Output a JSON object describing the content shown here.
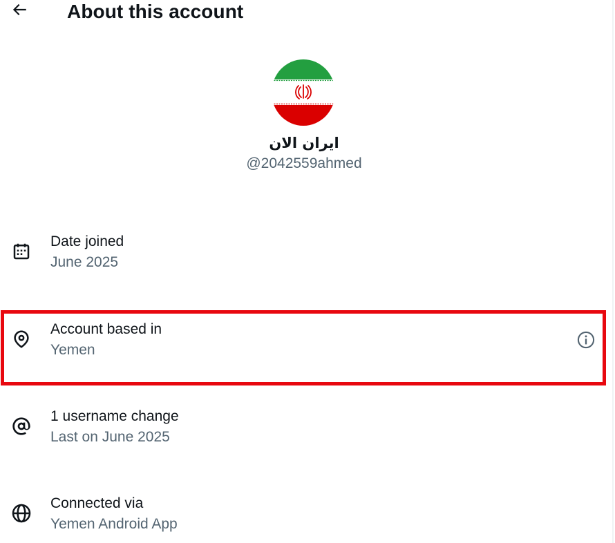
{
  "header": {
    "back_icon": "arrow-left-icon",
    "title": "About this account"
  },
  "profile": {
    "avatar": "iran-flag-avatar",
    "display_name": "ایران الان",
    "handle": "@2042559ahmed"
  },
  "info_rows": [
    {
      "icon": "calendar-icon",
      "label": "Date joined",
      "value": "June 2025"
    },
    {
      "icon": "location-pin-icon",
      "label": "Account based in",
      "value": "Yemen",
      "info_icon": "info-circle-icon",
      "highlighted": true
    },
    {
      "icon": "at-sign-icon",
      "label": "1 username change",
      "value": "Last on June 2025"
    },
    {
      "icon": "globe-icon",
      "label": "Connected via",
      "value": "Yemen Android App"
    }
  ],
  "colors": {
    "text_primary": "#0f1419",
    "text_secondary": "#536471",
    "highlight": "#e8080f",
    "flag_green": "#239f40",
    "flag_red": "#da0000"
  }
}
